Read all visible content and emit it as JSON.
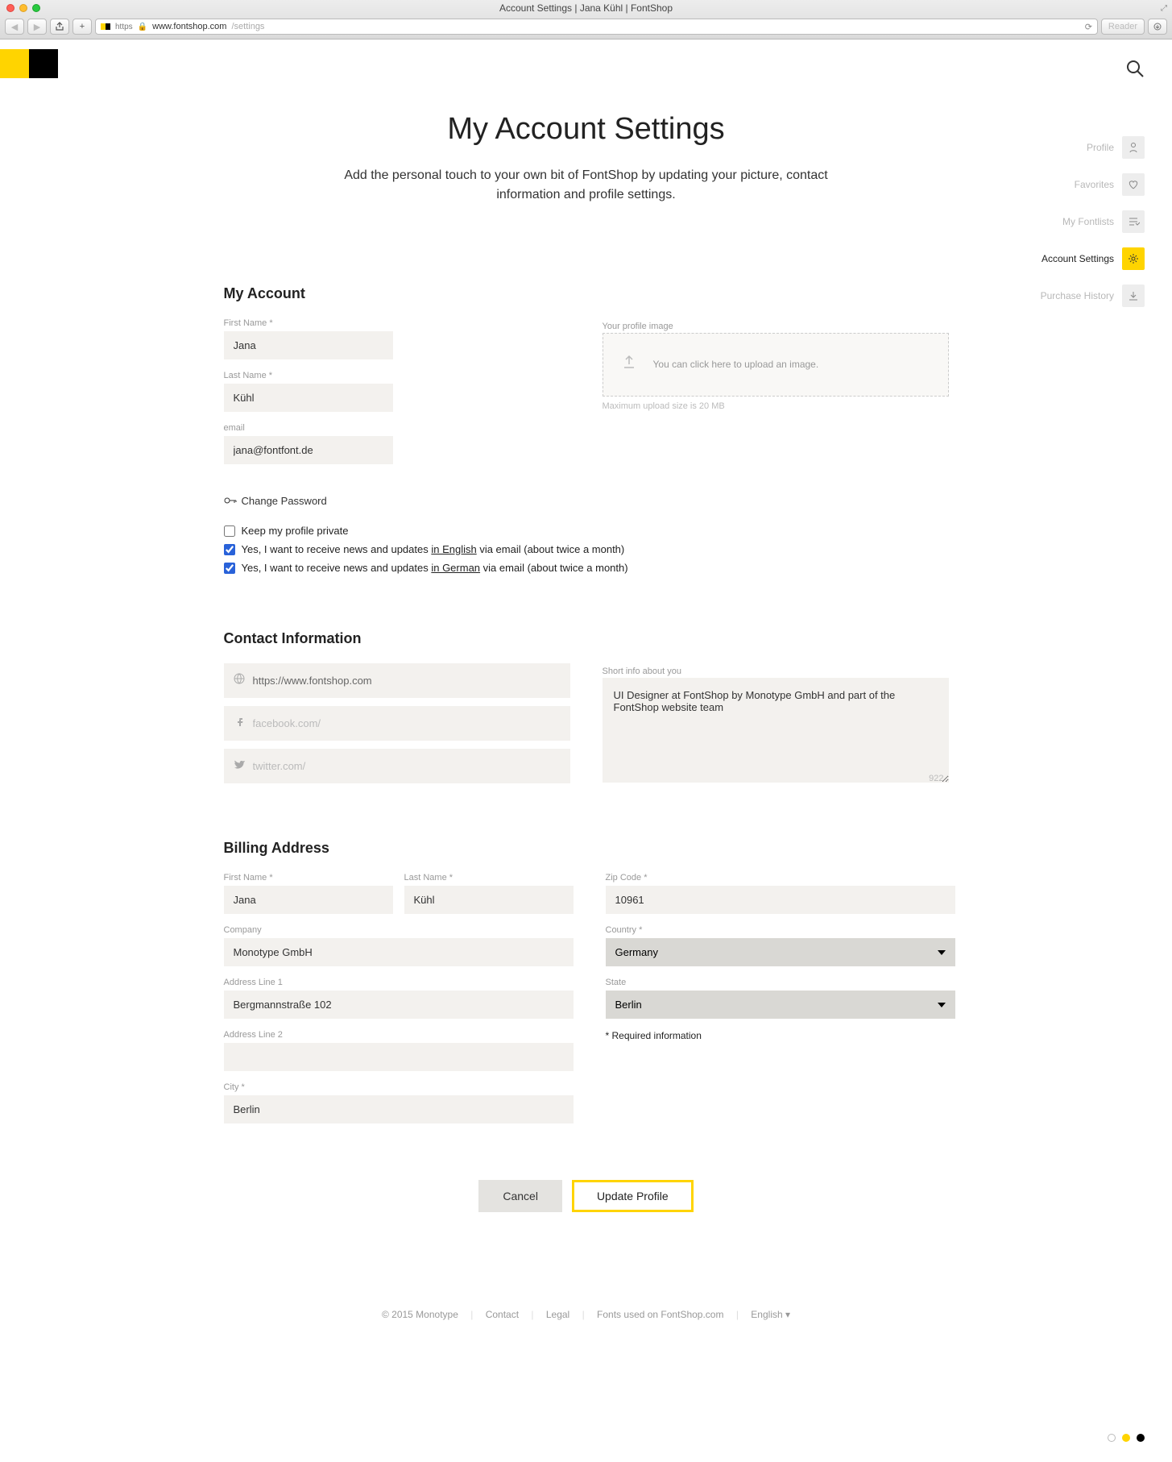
{
  "browser": {
    "title": "Account Settings | Jana Kühl | FontShop",
    "https_label": "https",
    "url_host": "www.fontshop.com",
    "url_path": "/settings",
    "reader": "Reader"
  },
  "header": {
    "page_title": "My Account Settings",
    "subtitle": "Add the personal touch to your own bit of FontShop by updating your picture, contact information and profile settings."
  },
  "sidenav": {
    "items": [
      {
        "label": "Profile"
      },
      {
        "label": "Favorites"
      },
      {
        "label": "My Fontlists"
      },
      {
        "label": "Account Settings"
      },
      {
        "label": "Purchase History"
      }
    ]
  },
  "account": {
    "section_title": "My Account",
    "first_name_label": "First Name *",
    "first_name_value": "Jana",
    "last_name_label": "Last Name *",
    "last_name_value": "Kühl",
    "email_label": "email",
    "email_value": "jana@fontfont.de",
    "change_password": "Change Password",
    "profile_image_label": "Your profile image",
    "upload_text": "You can click here to upload an image.",
    "upload_note": "Maximum upload size is 20 MB"
  },
  "checks": {
    "private_label": "Keep my profile private",
    "news_en_prefix": "Yes, I want to receive news and updates ",
    "news_en_lang": "in English",
    "news_en_suffix": " via email (about twice a month)",
    "news_de_prefix": "Yes, I want to receive news and updates ",
    "news_de_lang": "in German",
    "news_de_suffix": " via email (about twice a month)"
  },
  "contact": {
    "section_title": "Contact Information",
    "website_value": "https://www.fontshop.com",
    "facebook_placeholder": "facebook.com/",
    "twitter_placeholder": "twitter.com/",
    "about_label": "Short info about you",
    "about_value": "UI Designer at FontShop by Monotype GmbH and part of the FontShop website team",
    "charcount": "922"
  },
  "billing": {
    "section_title": "Billing Address",
    "first_name_label": "First Name *",
    "first_name_value": "Jana",
    "last_name_label": "Last Name *",
    "last_name_value": "Kühl",
    "company_label": "Company",
    "company_value": "Monotype GmbH",
    "address1_label": "Address Line 1",
    "address1_value": "Bergmannstraße 102",
    "address2_label": "Address Line 2",
    "address2_value": "",
    "city_label": "City *",
    "city_value": "Berlin",
    "zip_label": "Zip Code *",
    "zip_value": "10961",
    "country_label": "Country *",
    "country_value": "Germany",
    "state_label": "State",
    "state_value": "Berlin",
    "required_note": "* Required information"
  },
  "actions": {
    "cancel": "Cancel",
    "update": "Update Profile"
  },
  "footer": {
    "copyright": "© 2015 Monotype",
    "contact": "Contact",
    "legal": "Legal",
    "fonts": "Fonts used on FontShop.com",
    "language": "English  ▾"
  }
}
